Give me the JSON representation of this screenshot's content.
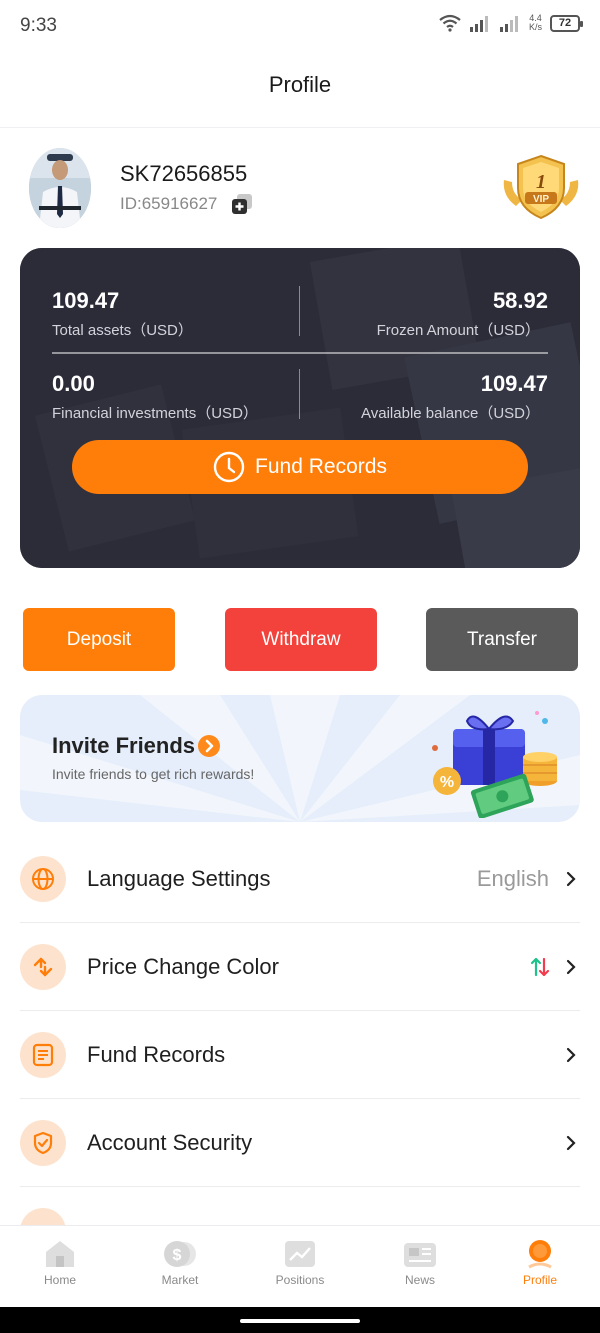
{
  "status_bar": {
    "time": "9:33",
    "net_speed_value": "4.4",
    "net_speed_unit": "K/s",
    "battery": "72"
  },
  "header": {
    "title": "Profile"
  },
  "user": {
    "username": "SK72656855",
    "id": "ID:65916627",
    "vip_level": "1",
    "vip_text": "VIP"
  },
  "assets": {
    "total_assets_value": "109.47",
    "total_assets_label": "Total assets（USD）",
    "frozen_value": "58.92",
    "frozen_label": "Frozen Amount（USD）",
    "financial_value": "0.00",
    "financial_label": "Financial investments（USD）",
    "available_value": "109.47",
    "available_label": "Available balance（USD）",
    "fund_records_button": "Fund Records"
  },
  "actions": [
    {
      "label": "Deposit",
      "color": "#ff7e0a"
    },
    {
      "label": "Withdraw",
      "color": "#f2423b"
    },
    {
      "label": "Transfer",
      "color": "#5a5a5a"
    }
  ],
  "invite": {
    "title": "Invite Friends",
    "subtitle": "Invite friends to get rich rewards!"
  },
  "menu": [
    {
      "label": "Language Settings",
      "value": "English",
      "icon": "globe-icon"
    },
    {
      "label": "Price Change Color",
      "value": "",
      "icon": "swap-icon"
    },
    {
      "label": "Fund Records",
      "value": "",
      "icon": "document-icon"
    },
    {
      "label": "Account Security",
      "value": "",
      "icon": "shield-check-icon"
    }
  ],
  "tabs": [
    {
      "label": "Home",
      "icon": "home-icon",
      "active": false
    },
    {
      "label": "Market",
      "icon": "coin-icon",
      "active": false
    },
    {
      "label": "Positions",
      "icon": "chart-icon",
      "active": false
    },
    {
      "label": "News",
      "icon": "news-icon",
      "active": false
    },
    {
      "label": "Profile",
      "icon": "profile-icon",
      "active": true
    }
  ],
  "colors": {
    "accent": "#ff7e0a",
    "card_bg": "#2b2c38",
    "withdraw": "#f2423b",
    "transfer": "#5a5a5a",
    "up_green": "#1ec28b",
    "down_red": "#f23d4f"
  }
}
